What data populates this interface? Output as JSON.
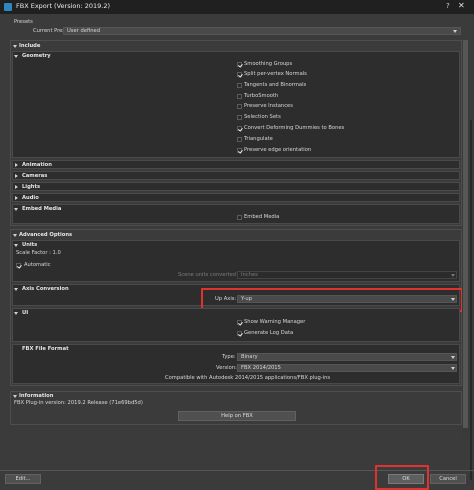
{
  "window": {
    "title": "FBX Export (Version: 2019.2)",
    "help_glyph": "?",
    "close_glyph": "✕"
  },
  "presets": {
    "header": "Presets",
    "current_label": "Current Preset:",
    "current_value": "User defined"
  },
  "include": {
    "header": "Include",
    "geometry": {
      "header": "Geometry",
      "options": [
        {
          "label": "Smoothing Groups",
          "checked": true
        },
        {
          "label": "Split per-vertex Normals",
          "checked": true
        },
        {
          "label": "Tangents and Binormals",
          "checked": false
        },
        {
          "label": "TurboSmooth",
          "checked": false
        },
        {
          "label": "Preserve Instances",
          "checked": false
        },
        {
          "label": "Selection Sets",
          "checked": false
        },
        {
          "label": "Convert Deforming Dummies to Bones",
          "checked": true
        },
        {
          "label": "Triangulate",
          "checked": false
        },
        {
          "label": "Preserve edge orientation",
          "checked": true
        }
      ]
    },
    "animation": "Animation",
    "cameras": "Cameras",
    "lights": "Lights",
    "audio": "Audio",
    "embed_media": {
      "header": "Embed Media",
      "option": "Embed Media",
      "checked": false
    }
  },
  "advanced": {
    "header": "Advanced Options",
    "units": {
      "header": "Units",
      "scale_factor": "Scale Factor : 1.0",
      "automatic": "Automatic",
      "automatic_checked": true,
      "convert_label": "Scene units converted to:",
      "convert_value": "Inches"
    },
    "axis": {
      "header": "Axis Conversion",
      "up_axis_label": "Up Axis:",
      "up_axis_value": "Y-up"
    },
    "ui": {
      "header": "UI",
      "show_warning": "Show Warning Manager",
      "show_warning_checked": true,
      "generate_log": "Generate Log Data",
      "generate_log_checked": true
    },
    "fbx_format": {
      "header": "FBX File Format",
      "type_label": "Type:",
      "type_value": "Binary",
      "version_label": "Version:",
      "version_value": "FBX 2014/2015",
      "compat_note": "Compatible with Autodesk 2014/2015 applications/FBX plug-ins"
    }
  },
  "information": {
    "header": "Information",
    "plugin_version": "FBX Plug-in version: 2019.2 Release (71e69bd5d)",
    "help_button": "Help on FBX"
  },
  "footer": {
    "edit_button": "Edit...",
    "ok_button": "OK",
    "cancel_button": "Cancel"
  },
  "colors": {
    "background": "#3b3b3b",
    "titlebar": "#202020",
    "highlight": "#e0322f"
  }
}
